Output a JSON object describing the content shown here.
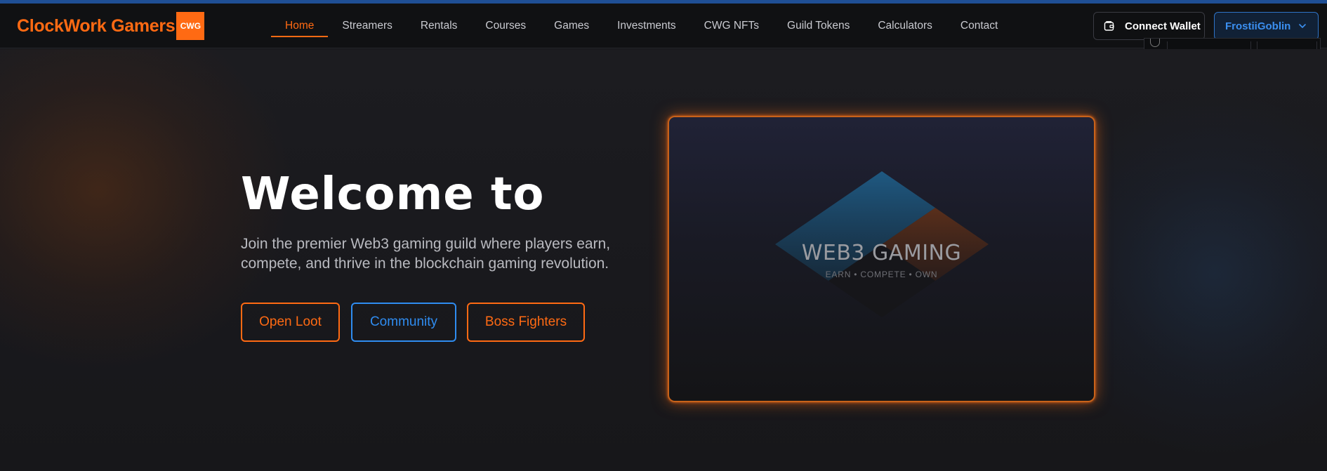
{
  "colors": {
    "accent": "#ff6a13",
    "secondary": "#2f8cf0",
    "background": "#151619",
    "nav_background": "#101113"
  },
  "brand": {
    "name": "ClockWork Gamers",
    "badge": "CWG"
  },
  "nav": {
    "items": [
      {
        "label": "Home",
        "active": true
      },
      {
        "label": "Streamers",
        "active": false
      },
      {
        "label": "Rentals",
        "active": false
      },
      {
        "label": "Courses",
        "active": false
      },
      {
        "label": "Games",
        "active": false
      },
      {
        "label": "Investments",
        "active": false
      },
      {
        "label": "CWG NFTs",
        "active": false
      },
      {
        "label": "Guild Tokens",
        "active": false
      },
      {
        "label": "Calculators",
        "active": false
      },
      {
        "label": "Contact",
        "active": false
      }
    ]
  },
  "header_actions": {
    "connect_wallet": {
      "label": "Connect Wallet",
      "icon": "wallet-icon"
    },
    "user_menu": {
      "label": "FrostiiGoblin",
      "icon": "chevron-down-icon"
    }
  },
  "hero": {
    "title": "Welcome to",
    "subtitle": "Join the premier Web3 gaming guild where players earn, compete, and thrive in the blockchain gaming revolution.",
    "buttons": [
      {
        "label": "Open Loot"
      },
      {
        "label": "Community"
      },
      {
        "label": "Boss Fighters"
      }
    ]
  },
  "media_card": {
    "title": "WEB3 GAMING",
    "tagline": "EARN • COMPETE • OWN"
  }
}
